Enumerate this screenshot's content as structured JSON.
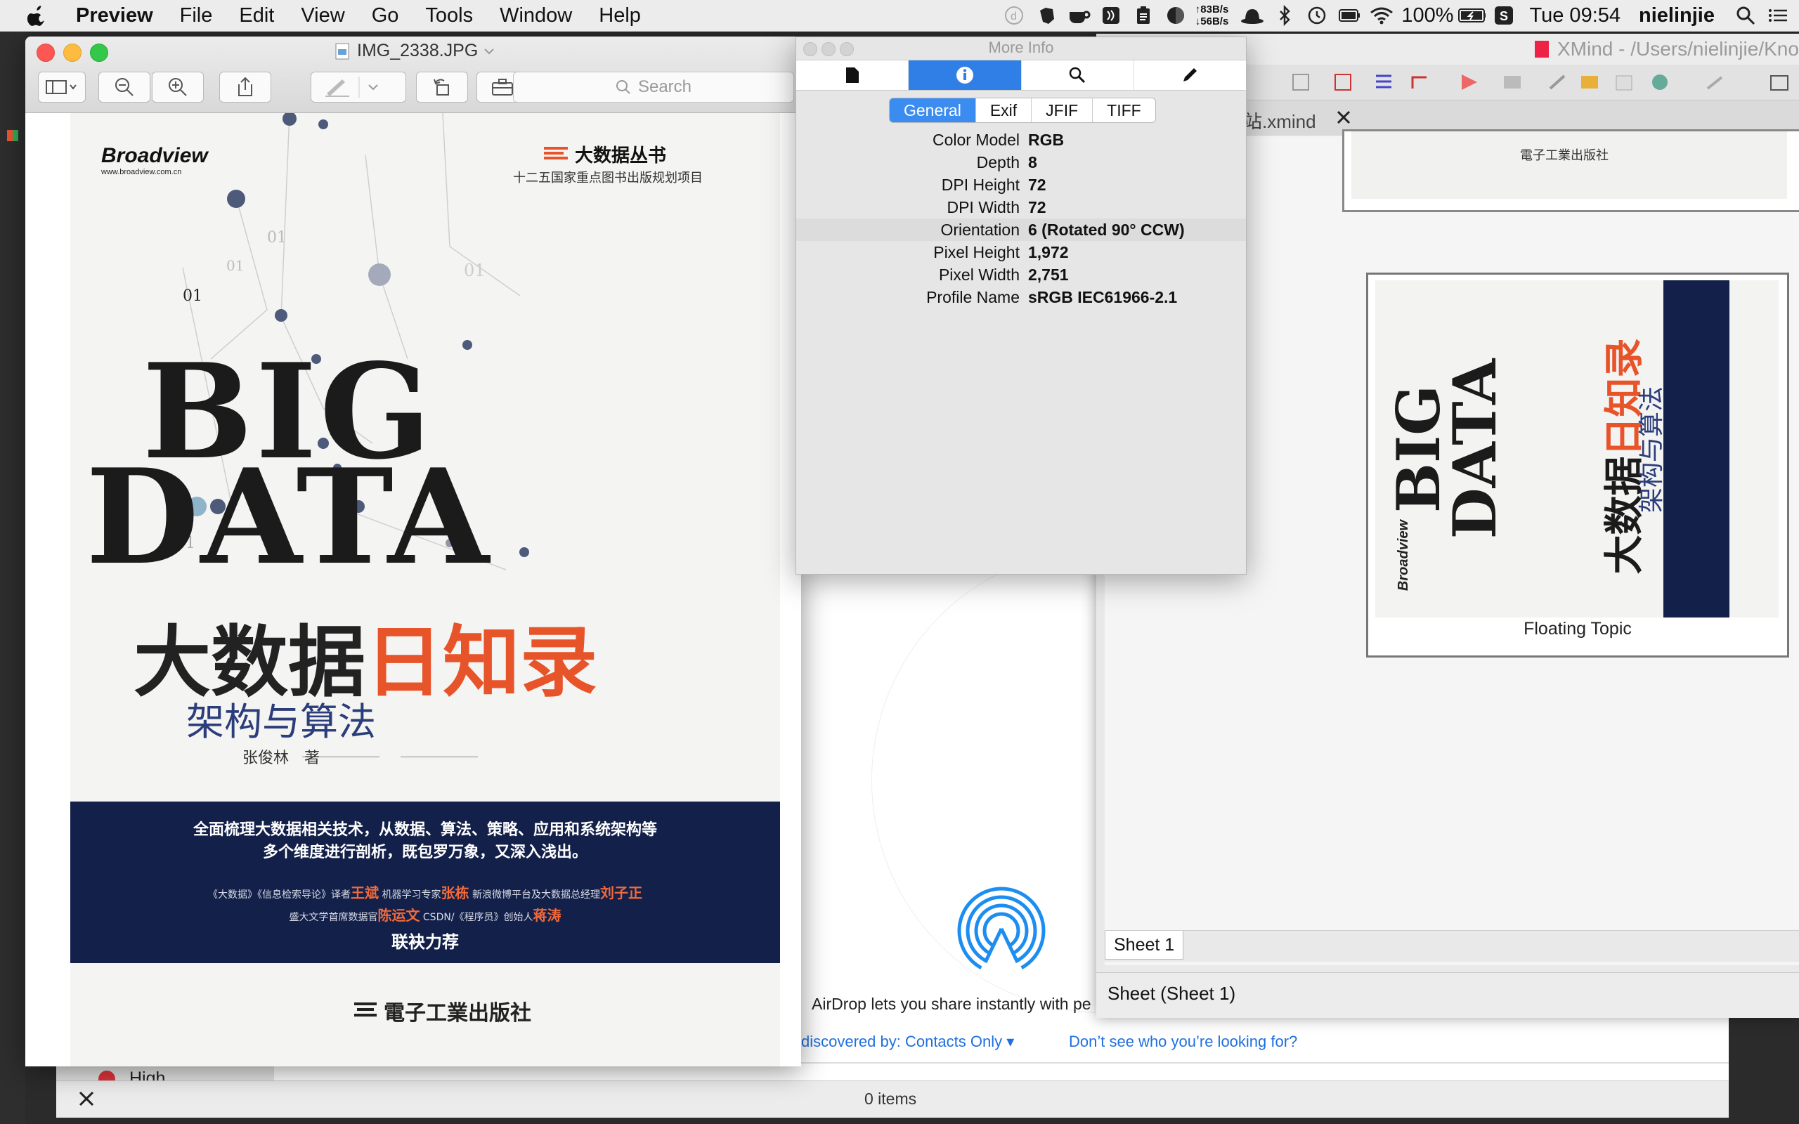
{
  "menubar": {
    "app_name": "Preview",
    "items": [
      "File",
      "Edit",
      "View",
      "Go",
      "Tools",
      "Window",
      "Help"
    ],
    "net_up": "↑83B/s",
    "net_down": "↓56B/s",
    "battery": "100%",
    "clock": "Tue 09:54",
    "user": "nielinjie"
  },
  "preview": {
    "title": "IMG_2338.JPG",
    "search_placeholder": "Search"
  },
  "cover": {
    "publisher_brand": "Broadview",
    "publisher_url": "www.broadview.com.cn",
    "series": "大数据丛书",
    "series_sub": "十二五国家重点图书出版规划项目",
    "title_en_1": "BIG",
    "title_en_2": "DATA",
    "title_cn_a": "大数据",
    "title_cn_b": "日知录",
    "subtitle_cn": "架构与算法",
    "author": "张俊林　著",
    "band_line1": "全面梳理大数据相关技术，从数据、算法、策略、应用和系统架构等",
    "band_line2": "多个维度进行剖析，既包罗万象，又深入浅出。",
    "band_rec1_a": "《大数据》《信息检索导论》译者",
    "band_rec1_b": "王斌",
    "band_rec1_c": "机器学习专家",
    "band_rec1_d": "张栋",
    "band_rec1_e": "新浪微博平台及大数据总经理",
    "band_rec1_f": "刘子正",
    "band_rec2_a": "盛大文学首席数据官",
    "band_rec2_b": "陈运文",
    "band_rec2_c": "CSDN/《程序员》创始人",
    "band_rec2_d": "蒋涛",
    "band_rec3": "联袂力荐",
    "bottom_publisher": "電子工業出版社",
    "digits": [
      "01",
      "01",
      "01",
      "01",
      "01"
    ]
  },
  "moreinfo": {
    "title": "More Info",
    "segments": [
      "General",
      "Exif",
      "JFIF",
      "TIFF"
    ],
    "selected_segment": "General",
    "rows": [
      {
        "k": "Color Model",
        "v": "RGB"
      },
      {
        "k": "Depth",
        "v": "8"
      },
      {
        "k": "DPI Height",
        "v": "72"
      },
      {
        "k": "DPI Width",
        "v": "72"
      },
      {
        "k": "Orientation",
        "v": "6 (Rotated 90° CCW)"
      },
      {
        "k": "Pixel Height",
        "v": "1,972"
      },
      {
        "k": "Pixel Width",
        "v": "2,751"
      },
      {
        "k": "Profile Name",
        "v": "sRGB IEC61966-2.1"
      }
    ]
  },
  "xmind": {
    "title": "XMind - /Users/nielinjie/Kno",
    "tab": "站.xmind",
    "floating_topic": "Floating Topic",
    "sheet_tab": "Sheet 1",
    "status": "Sheet (Sheet 1)"
  },
  "finder": {
    "airdrop_text": "AirDrop lets you share instantly with pe",
    "discovered": "discovered by: Contacts Only",
    "help_link": "Don’t see who you’re looking for?",
    "tag_label": "High",
    "items_count": "0 items"
  },
  "colors": {
    "accent": "#2f7fe6",
    "cover_orange": "#e8542a",
    "cover_navy": "#13204a",
    "subtitle_blue": "#2b3d7a"
  }
}
